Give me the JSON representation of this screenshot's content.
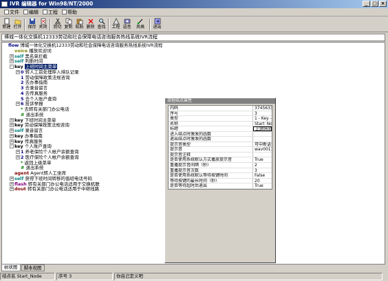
{
  "window": {
    "title": "IVR 编辑器 for Win98/NT/2000",
    "buttons": [
      "_",
      "□",
      "×"
    ]
  },
  "menubar": [
    {
      "label": "文件"
    },
    {
      "label": "编辑"
    },
    {
      "label": "工程"
    },
    {
      "label": "帮助"
    }
  ],
  "toolbar": [
    {
      "label": "新建",
      "icon": "new-file-icon"
    },
    {
      "label": "打开",
      "icon": "open-folder-icon"
    },
    {
      "label": "保存",
      "icon": "save-icon"
    },
    {
      "label": "关闭",
      "icon": "close-doc-icon"
    },
    {
      "label": "剪切",
      "icon": "cut-icon"
    },
    {
      "label": "复制",
      "icon": "copy-icon"
    },
    {
      "label": "粘贴",
      "icon": "paste-icon"
    },
    {
      "label": "删除",
      "icon": "delete-icon"
    },
    {
      "label": "查找",
      "icon": "find-icon"
    },
    {
      "label": "工程",
      "icon": "project-icon"
    },
    {
      "label": "语音",
      "icon": "voice-icon"
    },
    {
      "label": "风格",
      "icon": "style-icon"
    },
    {
      "label": "退出",
      "icon": "exit-icon"
    }
  ],
  "caption": "博城一体化交换机12333劳动和社会保障电话咨询服务热线系统IVR流程",
  "tree": [
    {
      "indent": 0,
      "exp": "",
      "kw": "flow",
      "kwclass": "flow",
      "text": "博城一体化交换机12333劳动和社会保障电话咨询服务热线系统IVR流程"
    },
    {
      "indent": 1,
      "exp": "",
      "kw": "voice",
      "kwclass": "voice",
      "text": "播放欢迎词"
    },
    {
      "indent": 1,
      "exp": "+",
      "kw": "self",
      "kwclass": "self",
      "text": "黑名单拦截"
    },
    {
      "indent": 1,
      "exp": "+",
      "kw": "self",
      "kwclass": "self",
      "text": "判断时间"
    },
    {
      "indent": 1,
      "exp": "-",
      "kw": "key",
      "kwclass": "key",
      "text": "上班时间主菜单",
      "hl": true
    },
    {
      "indent": 2,
      "exp": "+",
      "kw": "0",
      "kwclass": "num",
      "text": "转人工前处理呼入排队记录"
    },
    {
      "indent": 2,
      "exp": "",
      "kw": "1",
      "kwclass": "num",
      "text": "劳动保障政策法规咨询"
    },
    {
      "indent": 2,
      "exp": "",
      "kw": "2",
      "kwclass": "num",
      "text": "去办事指南"
    },
    {
      "indent": 2,
      "exp": "",
      "kw": "3",
      "kwclass": "num",
      "text": "去录音留言"
    },
    {
      "indent": 2,
      "exp": "",
      "kw": "4",
      "kwclass": "num",
      "text": "去传真服务"
    },
    {
      "indent": 2,
      "exp": "",
      "kw": "5",
      "kwclass": "num",
      "text": "去个人账户查询"
    },
    {
      "indent": 2,
      "exp": "+",
      "kw": "6",
      "kwclass": "num",
      "text": "投诉举报"
    },
    {
      "indent": 2,
      "exp": "",
      "kw": "*",
      "kwclass": "star",
      "text": "去转有关部门办公电话"
    },
    {
      "indent": 2,
      "exp": "",
      "kw": "#",
      "kwclass": "hashsym",
      "text": "退出系统"
    },
    {
      "indent": 1,
      "exp": "+",
      "kw": "key",
      "kwclass": "key",
      "text": "下班时间主菜单"
    },
    {
      "indent": 1,
      "exp": "+",
      "kw": "key",
      "kwclass": "key",
      "text": "劳动保障政策法规咨询"
    },
    {
      "indent": 1,
      "exp": "+",
      "kw": "self",
      "kwclass": "self",
      "text": "录音留言"
    },
    {
      "indent": 1,
      "exp": "+",
      "kw": "key",
      "kwclass": "key",
      "text": "办事指南"
    },
    {
      "indent": 1,
      "exp": "+",
      "kw": "key",
      "kwclass": "key",
      "text": "传真服务"
    },
    {
      "indent": 1,
      "exp": "-",
      "kw": "key",
      "kwclass": "key",
      "text": "个人账户查询"
    },
    {
      "indent": 2,
      "exp": "+",
      "kw": "1",
      "kwclass": "num",
      "text": "养老保险个人帐户余额查询"
    },
    {
      "indent": 2,
      "exp": "+",
      "kw": "2",
      "kwclass": "num",
      "text": "医疗保险个人帐户余额查询"
    },
    {
      "indent": 2,
      "exp": "",
      "kw": "*",
      "kwclass": "star",
      "text": "返回上级菜单"
    },
    {
      "indent": 2,
      "exp": "",
      "kw": "#",
      "kwclass": "hashsym",
      "text": "退出系统"
    },
    {
      "indent": 1,
      "exp": "",
      "kw": "agent",
      "kwclass": "agent",
      "text": "Agent转人工坐席"
    },
    {
      "indent": 1,
      "exp": "+",
      "kw": "self",
      "kwclass": "self",
      "text": "获得下班时间转移的值班电话号码"
    },
    {
      "indent": 1,
      "exp": "+",
      "kw": "flash",
      "kwclass": "flash",
      "text": "转有关部门办公电话适用于交换机联"
    },
    {
      "indent": 1,
      "exp": "+",
      "kw": "dout",
      "kwclass": "dout",
      "text": "转有关部门办公电话适用于中继线路"
    }
  ],
  "properties": {
    "title": "流程结点属性",
    "rows": [
      {
        "key": "内码",
        "value": "3745633721604"
      },
      {
        "key": "序号",
        "value": "3"
      },
      {
        "key": "类型",
        "value": "1 - Key - 按键"
      },
      {
        "key": "名称",
        "value": "Start_Node"
      },
      {
        "key": "标题",
        "value": "上班时间主菜单",
        "selected": true
      },
      {
        "key": "进入结点时激发的函数",
        "value": ""
      },
      {
        "key": "退出结点时激发的函数",
        "value": ""
      },
      {
        "key": "提示音类型",
        "value": "可中断语音文件"
      },
      {
        "key": "提示音",
        "value": "wav0011.wav"
      },
      {
        "key": "提示音注释",
        "value": ""
      },
      {
        "key": "是否使用系统默认方式播放提示音",
        "value": "True"
      },
      {
        "key": "重播提示音间隔（秒）",
        "value": "2"
      },
      {
        "key": "重播提示音次数",
        "value": "3"
      },
      {
        "key": "是否使用系统默认等待按键时间",
        "value": "False"
      },
      {
        "key": "等待按键的最长时间（秒）",
        "value": "20"
      },
      {
        "key": "是否等待超时后退出",
        "value": "True"
      }
    ]
  },
  "tabs": [
    {
      "label": "树状图",
      "active": true
    },
    {
      "label": "脚本视图",
      "active": false
    }
  ],
  "status": {
    "node": "结点名 Start_Node",
    "seq": "序号 3",
    "comment": "你自己定义吧"
  }
}
